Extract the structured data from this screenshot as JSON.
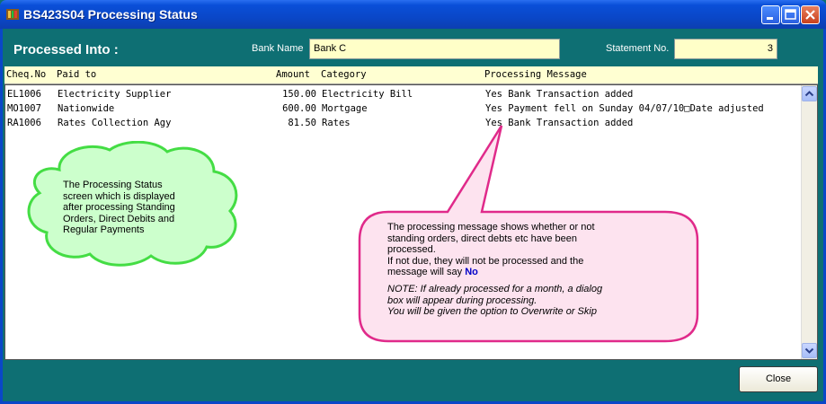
{
  "window": {
    "title": "BS423S04  Processing Status"
  },
  "form": {
    "processed_into_label": "Processed Into :",
    "bank_name_label": "Bank Name",
    "bank_name_value": "Bank C",
    "statement_no_label": "Statement No.",
    "statement_no_value": "3"
  },
  "grid": {
    "headers": {
      "cheq_no": "Cheq.No",
      "paid_to": "Paid to",
      "amount": "Amount",
      "category": "Category",
      "processing_message": "Processing Message"
    },
    "rows": [
      {
        "cheq_no": "EL1006",
        "paid_to": "Electricity Supplier",
        "amount": "150.00",
        "category": "Electricity Bill",
        "message": "Yes Bank Transaction added"
      },
      {
        "cheq_no": "MO1007",
        "paid_to": "Nationwide",
        "amount": "600.00",
        "category": "Mortgage",
        "message": "Yes Payment fell on Sunday 04/07/10□Date adjusted"
      },
      {
        "cheq_no": "RA1006",
        "paid_to": "Rates Collection Agy",
        "amount": "81.50",
        "category": "Rates",
        "message": "Yes Bank Transaction added"
      }
    ]
  },
  "callout_green": {
    "lines": [
      "The Processing Status",
      "screen which is displayed",
      "after processing Standing",
      "Orders, Direct Debits and",
      "Regular Payments"
    ]
  },
  "callout_pink": {
    "line1": "The processing message shows whether or not",
    "line2": "standing orders, direct debts etc have been",
    "line3": "processed.",
    "line4": "If not due, they will not be processed and the",
    "line5_prefix": "message will say ",
    "line5_emph": "No",
    "note1": "NOTE: If already processed for a month, a dialog",
    "note2": "box will appear during processing.",
    "note3": "You will be given the option to Overwrite or Skip"
  },
  "buttons": {
    "close_label": "Close"
  },
  "colors": {
    "background": "#0e6f73",
    "field_bg": "#ffffc8",
    "green_cloud_fill": "#ccffcc",
    "green_cloud_border": "#44dd44",
    "pink_callout_fill": "#fde3ef",
    "pink_callout_border": "#e02a8a",
    "emphasis_no": "#0000c8"
  }
}
